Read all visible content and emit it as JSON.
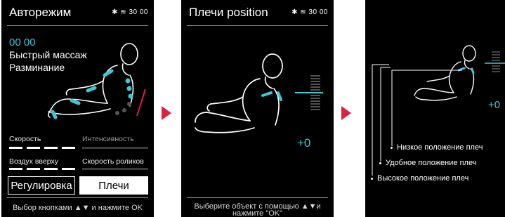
{
  "status_bar": {
    "bt_icon": "bluetooth-icon",
    "heat_icon": "heat-icon",
    "time": "30 00"
  },
  "screen1": {
    "title": "Авторежим",
    "timer": "00 00",
    "mode_line1": "Быстрый массаж",
    "mode_line2": "Разминание",
    "speed_label": "Скорость",
    "intensity_label": "Интенсивность",
    "air_label": "Воздух вверху",
    "roller_label": "Скорость роликов",
    "adjust_button": "Регулировка",
    "shoulders_button": "Плечи",
    "hint": "Выбор кнопками ▲▼ и нажмите OK"
  },
  "screen2": {
    "title": "Плечи position",
    "offset": "+0",
    "hint_line1": "Выберите объект с помощью ▲▼и",
    "hint_line2": "нажмите \"OK\""
  },
  "screen3": {
    "offset": "+0",
    "legend": [
      "Низкое положение плеч",
      "Удобное положение плеч",
      "Высокое положение плеч"
    ]
  },
  "colors": {
    "accent": "#3cc8d6",
    "arrow": "#e02040",
    "background": "#000000"
  }
}
